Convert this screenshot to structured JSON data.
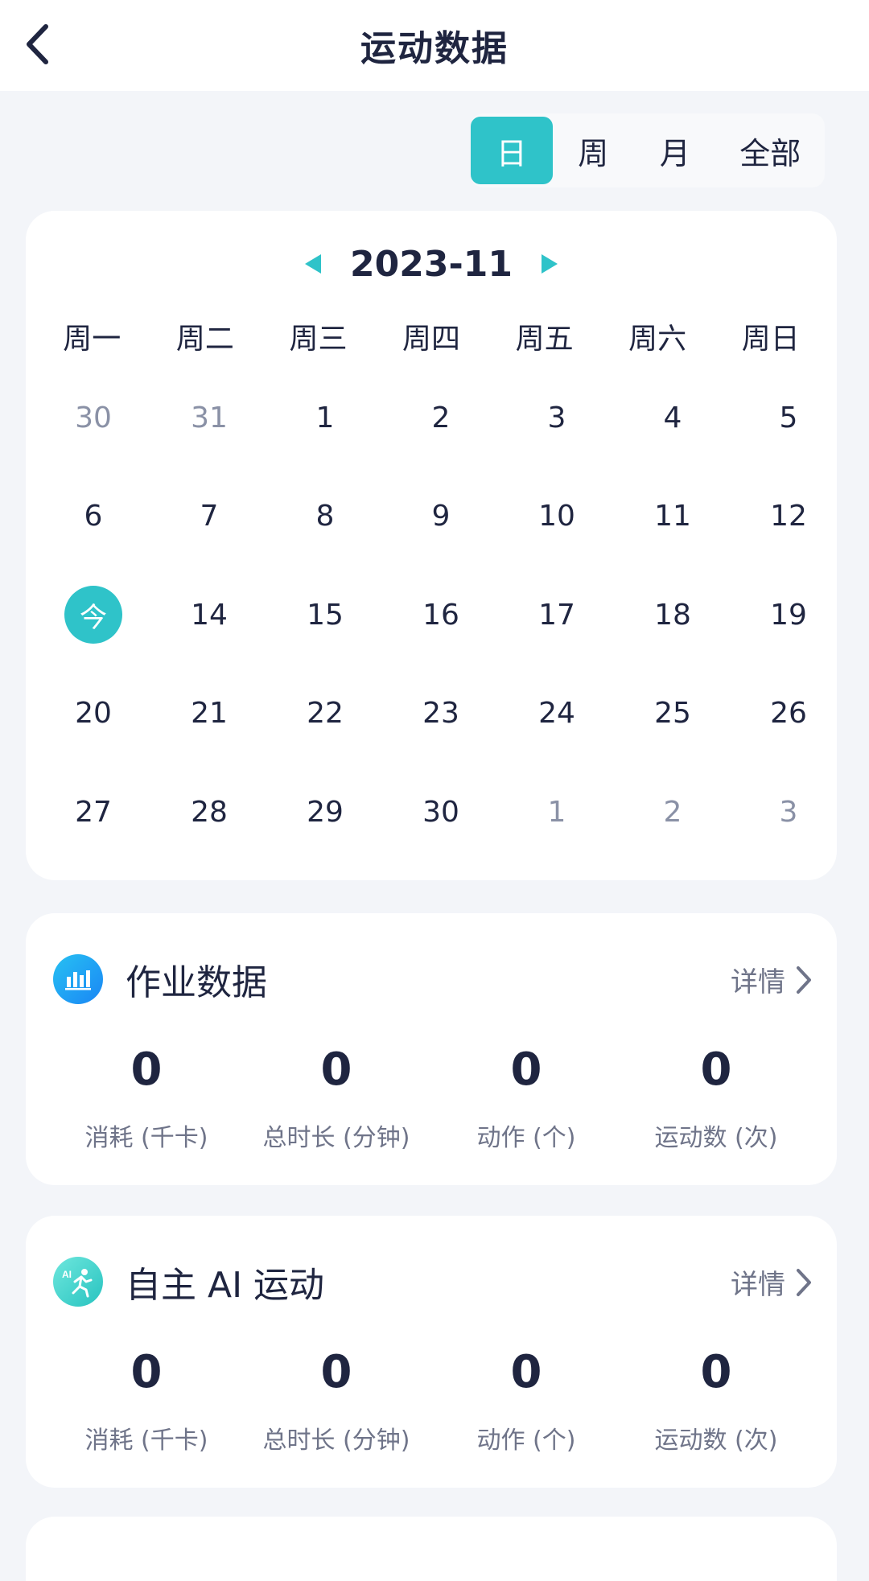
{
  "header": {
    "title": "运动数据",
    "back_icon": "chevron-left-icon"
  },
  "period_tabs": [
    {
      "label": "日",
      "active": true
    },
    {
      "label": "周",
      "active": false
    },
    {
      "label": "月",
      "active": false
    },
    {
      "label": "全部",
      "active": false
    }
  ],
  "calendar": {
    "month": "2023-11",
    "prev_icon": "triangle-left-icon",
    "next_icon": "triangle-right-icon",
    "weekdays": [
      "周一",
      "周二",
      "周三",
      "周四",
      "周五",
      "周六",
      "周日"
    ],
    "days": [
      {
        "label": "30",
        "muted": true
      },
      {
        "label": "31",
        "muted": true
      },
      {
        "label": "1"
      },
      {
        "label": "2"
      },
      {
        "label": "3"
      },
      {
        "label": "4"
      },
      {
        "label": "5"
      },
      {
        "label": "6"
      },
      {
        "label": "7"
      },
      {
        "label": "8"
      },
      {
        "label": "9"
      },
      {
        "label": "10"
      },
      {
        "label": "11"
      },
      {
        "label": "12"
      },
      {
        "label": "今",
        "today": true
      },
      {
        "label": "14"
      },
      {
        "label": "15"
      },
      {
        "label": "16"
      },
      {
        "label": "17"
      },
      {
        "label": "18"
      },
      {
        "label": "19"
      },
      {
        "label": "20"
      },
      {
        "label": "21"
      },
      {
        "label": "22"
      },
      {
        "label": "23"
      },
      {
        "label": "24"
      },
      {
        "label": "25"
      },
      {
        "label": "26"
      },
      {
        "label": "27"
      },
      {
        "label": "28"
      },
      {
        "label": "29"
      },
      {
        "label": "30"
      },
      {
        "label": "1",
        "muted": true
      },
      {
        "label": "2",
        "muted": true
      },
      {
        "label": "3",
        "muted": true
      }
    ]
  },
  "homework": {
    "title": "作业数据",
    "detail": "详情",
    "icon": "bar-chart-icon",
    "stats": [
      {
        "value": "0",
        "label": "消耗 (千卡)"
      },
      {
        "value": "0",
        "label": "总时长 (分钟)"
      },
      {
        "value": "0",
        "label": "动作 (个)"
      },
      {
        "value": "0",
        "label": "运动数 (次)"
      }
    ]
  },
  "ai_sport": {
    "title": "自主 AI 运动",
    "detail": "详情",
    "icon": "ai-running-icon",
    "icon_text": "AI",
    "stats": [
      {
        "value": "0",
        "label": "消耗 (千卡)"
      },
      {
        "value": "0",
        "label": "总时长 (分钟)"
      },
      {
        "value": "0",
        "label": "动作 (个)"
      },
      {
        "value": "0",
        "label": "运动数 (次)"
      }
    ]
  },
  "colors": {
    "accent": "#2fc3c9",
    "text": "#1f2540",
    "muted": "#8a91a6",
    "background": "#f3f5f9",
    "homework_icon": "#1a9bf5"
  }
}
